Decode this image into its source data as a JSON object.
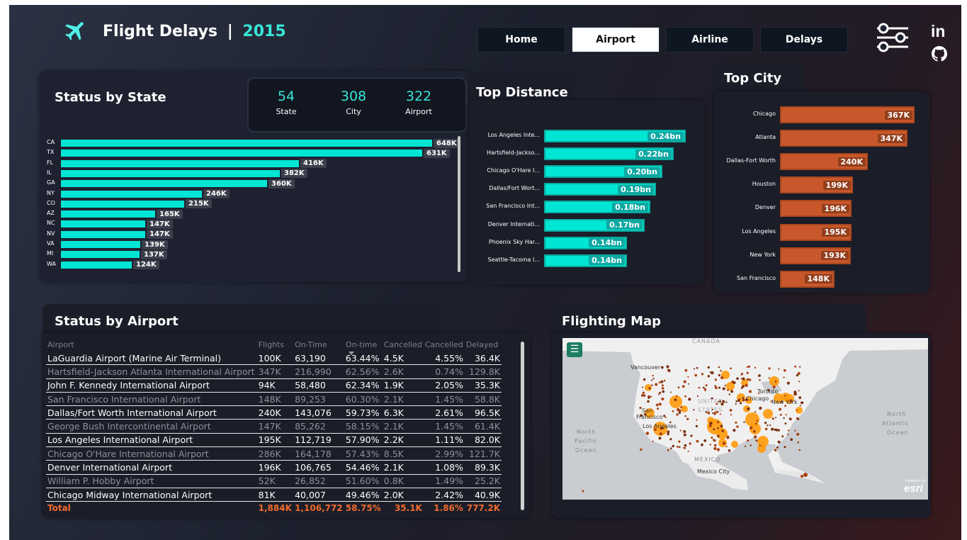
{
  "header": {
    "title": "Flight Delays",
    "separator": "|",
    "year": "2015"
  },
  "nav": {
    "items": [
      "Home",
      "Airport",
      "Airline",
      "Delays"
    ],
    "active": "Airport"
  },
  "social": {
    "linkedin_label": "in"
  },
  "status_by_state": {
    "title": "Status by State",
    "kpis": [
      {
        "value": "54",
        "label": "State"
      },
      {
        "value": "308",
        "label": "City"
      },
      {
        "value": "322",
        "label": "Airport"
      }
    ]
  },
  "top_distance": {
    "title": "Top Distance"
  },
  "top_city": {
    "title": "Top City"
  },
  "status_by_airport": {
    "title": "Status by Airport",
    "columns": [
      "Airport",
      "Flights",
      "On-Time",
      "On-time",
      "Cancelled",
      "Cancelled",
      "Delayed"
    ],
    "rows": [
      [
        "LaGuardia Airport (Marine Air Terminal)",
        "100K",
        "63,190",
        "63.44%",
        "4.5K",
        "4.55%",
        "36.4K"
      ],
      [
        "Hartsfield-Jackson Atlanta International Airport",
        "347K",
        "216,990",
        "62.56%",
        "2.6K",
        "0.74%",
        "129.8K"
      ],
      [
        "John F. Kennedy International Airport",
        "94K",
        "58,480",
        "62.34%",
        "1.9K",
        "2.05%",
        "35.3K"
      ],
      [
        "San Francisco International Airport",
        "148K",
        "89,253",
        "60.30%",
        "2.1K",
        "1.45%",
        "58.8K"
      ],
      [
        "Dallas/Fort Worth International Airport",
        "240K",
        "143,076",
        "59.73%",
        "6.3K",
        "2.61%",
        "96.5K"
      ],
      [
        "George Bush Intercontinental Airport",
        "147K",
        "85,262",
        "58.15%",
        "2.1K",
        "1.45%",
        "61.4K"
      ],
      [
        "Los Angeles International Airport",
        "195K",
        "112,719",
        "57.90%",
        "2.2K",
        "1.11%",
        "82.0K"
      ],
      [
        "Chicago O'Hare International Airport",
        "286K",
        "164,178",
        "57.43%",
        "8.5K",
        "2.99%",
        "121.7K"
      ],
      [
        "Denver International Airport",
        "196K",
        "106,765",
        "54.46%",
        "2.1K",
        "1.08%",
        "89.3K"
      ],
      [
        "William P. Hobby Airport",
        "52K",
        "26,852",
        "51.60%",
        "0.8K",
        "1.49%",
        "25.2K"
      ],
      [
        "Chicago Midway International Airport",
        "81K",
        "40,007",
        "49.46%",
        "2.0K",
        "2.42%",
        "40.9K"
      ]
    ],
    "total": [
      "Total",
      "1,884K",
      "1,106,772",
      "58.75%",
      "35.1K",
      "1.86%",
      "777.2K"
    ]
  },
  "flighting_map": {
    "title": "Flighting Map",
    "labels": [
      "CANADA",
      "Vancouver",
      "UNITED",
      "STATES",
      "Toronto",
      "Chicago",
      "New York",
      "San",
      "Francisco",
      "Los Angeles",
      "North",
      "Pacific",
      "Ocean",
      "North",
      "Atlantic",
      "Ocean",
      "MÉXICO",
      "Mexico City",
      "esri"
    ],
    "esri_small": "Powered by"
  },
  "chart_data": [
    {
      "type": "bar",
      "title": "Status by State",
      "categories": [
        "CA",
        "TX",
        "FL",
        "IL",
        "GA",
        "NY",
        "CO",
        "AZ",
        "NC",
        "NV",
        "VA",
        "MI",
        "WA"
      ],
      "values": [
        648,
        631,
        416,
        382,
        360,
        246,
        215,
        165,
        147,
        147,
        139,
        137,
        124
      ],
      "value_labels": [
        "648K",
        "631K",
        "416K",
        "382K",
        "360K",
        "246K",
        "215K",
        "165K",
        "147K",
        "147K",
        "139K",
        "137K",
        "124K"
      ],
      "unit": "K",
      "color": "#00e5d4"
    },
    {
      "type": "bar",
      "title": "Top Distance",
      "categories": [
        "Los Angeles Inte...",
        "Hartsfield-Jackso...",
        "Chicago O'Hare I...",
        "Dallas/Fort Wort...",
        "San Francisco Int...",
        "Denver Internati...",
        "Phoenix Sky Har...",
        "Seattle-Tacoma I..."
      ],
      "values": [
        0.24,
        0.22,
        0.2,
        0.19,
        0.18,
        0.17,
        0.14,
        0.14
      ],
      "value_labels": [
        "0.24bn",
        "0.22bn",
        "0.20bn",
        "0.19bn",
        "0.18bn",
        "0.17bn",
        "0.14bn",
        "0.14bn"
      ],
      "unit": "bn",
      "color": "#00e5d4"
    },
    {
      "type": "bar",
      "title": "Top City",
      "categories": [
        "Chicago",
        "Atlanta",
        "Dallas-Fort Worth",
        "Houston",
        "Denver",
        "Los Angeles",
        "New York",
        "San Francisco"
      ],
      "values": [
        367,
        347,
        240,
        199,
        196,
        195,
        193,
        148
      ],
      "value_labels": [
        "367K",
        "347K",
        "240K",
        "199K",
        "196K",
        "195K",
        "193K",
        "148K"
      ],
      "unit": "K",
      "color": "#c8582b"
    }
  ]
}
